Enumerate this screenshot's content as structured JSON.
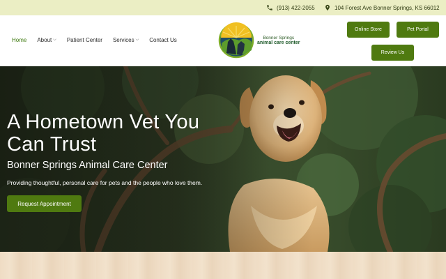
{
  "topbar": {
    "phone": "(913) 422-2055",
    "address": "104 Forest Ave Bonner Springs, KS 66012",
    "phone_icon": "phone-icon",
    "location_icon": "map-pin-icon"
  },
  "nav": {
    "items": [
      {
        "label": "Home",
        "active": true
      },
      {
        "label": "About",
        "dropdown": true
      },
      {
        "label": "Patient Center"
      },
      {
        "label": "Services",
        "dropdown": true
      },
      {
        "label": "Contact Us"
      }
    ]
  },
  "logo": {
    "line1": "Bonner Springs",
    "line2": "animal care center"
  },
  "header_buttons": {
    "online_store": "Online Store",
    "pet_portal": "Pet Portal",
    "review_us": "Review Us"
  },
  "hero": {
    "title": "A Hometown Vet You Can Trust",
    "subtitle": "Bonner Springs Animal Care Center",
    "description": "Providing thoughtful, personal care for pets and the people who love them.",
    "cta": "Request Appointment"
  },
  "colors": {
    "accent": "#4f7a10",
    "topbar_bg": "#ebeec4",
    "nav_active": "#3f7a10"
  }
}
